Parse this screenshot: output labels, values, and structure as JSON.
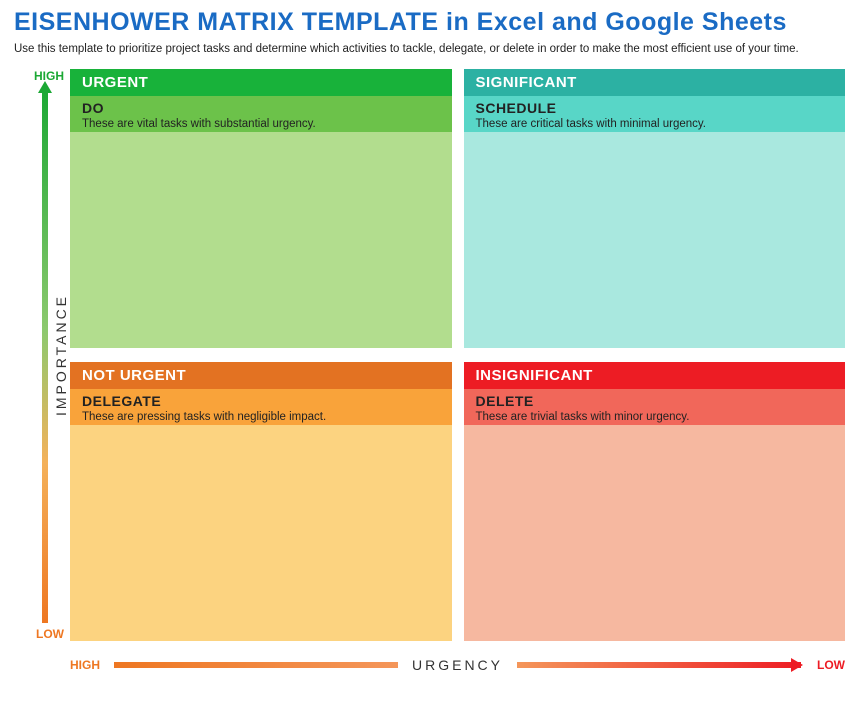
{
  "header": {
    "title": "EISENHOWER MATRIX TEMPLATE in Excel and Google Sheets",
    "subtitle": "Use this template to prioritize project tasks and determine which activities to tackle, delegate, or delete in order to make the most efficient use of your time."
  },
  "axes": {
    "y_label": "IMPORTANCE",
    "y_high": "HIGH",
    "y_low": "LOW",
    "x_label": "URGENCY",
    "x_high": "HIGH",
    "x_low": "LOW"
  },
  "quadrants": [
    {
      "category": "URGENT",
      "action": "DO",
      "description": "These are vital tasks with substantial urgency."
    },
    {
      "category": "SIGNIFICANT",
      "action": "SCHEDULE",
      "description": "These are critical tasks with minimal urgency."
    },
    {
      "category": "NOT URGENT",
      "action": "DELEGATE",
      "description": "These are pressing tasks with negligible impact."
    },
    {
      "category": "INSIGNIFICANT",
      "action": "DELETE",
      "description": "These are trivial tasks with minor urgency."
    }
  ]
}
